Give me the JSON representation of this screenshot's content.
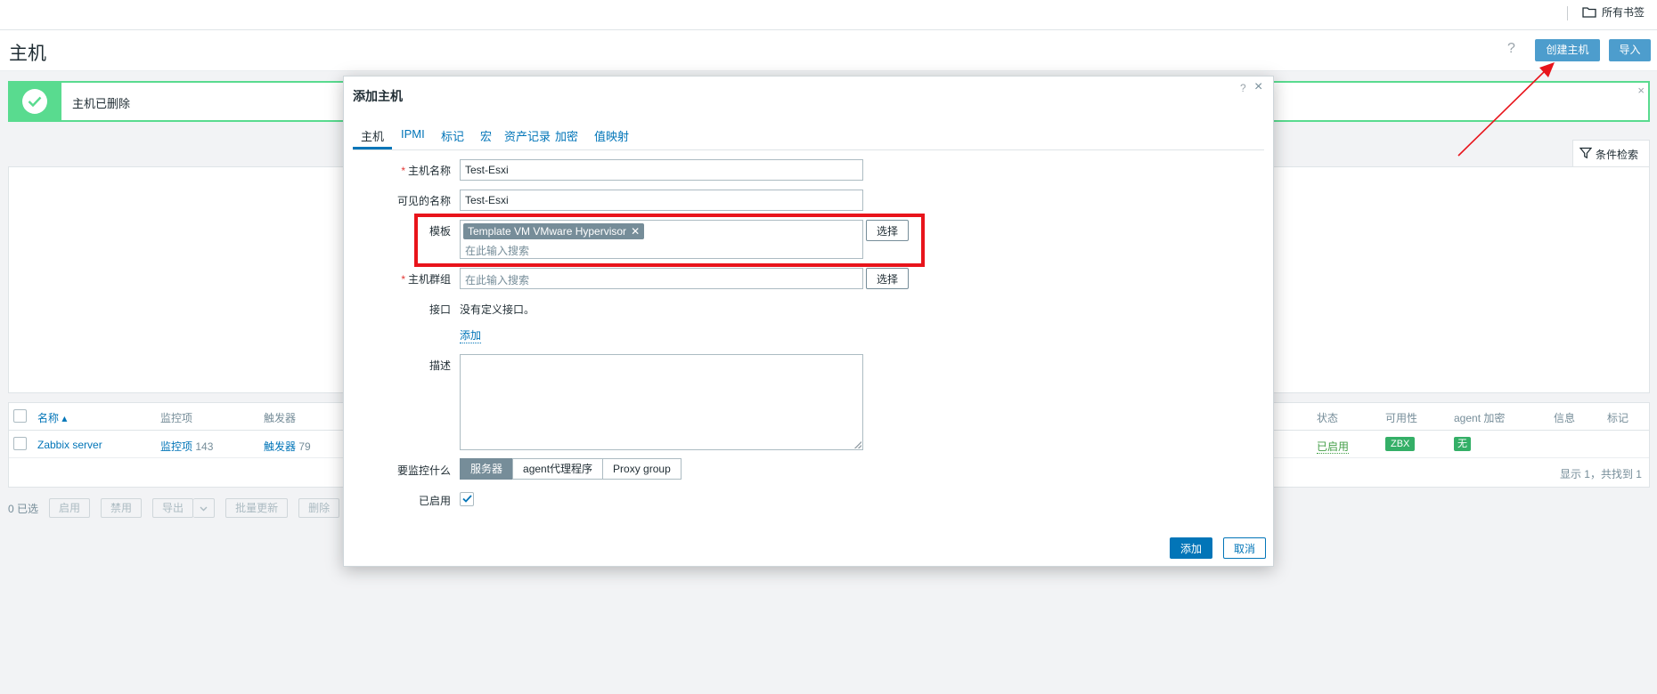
{
  "bookmarks": {
    "label": "所有书签",
    "icon": "folder-icon"
  },
  "header": {
    "title": "主机",
    "help": "?",
    "create_host": "创建主机",
    "import": "导入"
  },
  "message": {
    "text": "主机已删除",
    "icon": "check-circle-icon",
    "close": "×"
  },
  "filter": {
    "label": "条件检索",
    "icon": "funnel-icon"
  },
  "table": {
    "columns": {
      "name": "名称 ▴",
      "items": "监控项",
      "triggers": "触发器",
      "status": "状态",
      "availability": "可用性",
      "agent_encryption": "agent 加密",
      "info": "信息",
      "tags": "标记"
    },
    "rows": [
      {
        "name": "Zabbix server",
        "items_label": "监控项",
        "items_count": "143",
        "triggers_label": "触发器",
        "triggers_count": "79",
        "status": "已启用",
        "availability": "ZBX",
        "encryption": "无"
      }
    ],
    "footer": "显示 1，共找到 1"
  },
  "actions": {
    "selected": "0 已选",
    "enable": "启用",
    "disable": "禁用",
    "export": "导出",
    "mass_update": "批量更新",
    "delete": "删除"
  },
  "modal": {
    "title": "添加主机",
    "help": "?",
    "close": "×",
    "tabs": [
      "主机",
      "IPMI",
      "标记",
      "宏",
      "资产记录",
      "加密",
      "值映射"
    ],
    "fields": {
      "host_name_label": "主机名称",
      "host_name_value": "Test-Esxi",
      "visible_name_label": "可见的名称",
      "visible_name_value": "Test-Esxi",
      "templates_label": "模板",
      "template_chip": "Template VM VMware Hypervisor",
      "template_chip_remove": "✕",
      "search_placeholder": "在此输入搜索",
      "select": "选择",
      "host_groups_label": "主机群组",
      "interfaces_label": "接口",
      "interfaces_text": "没有定义接口。",
      "add_link": "添加",
      "description_label": "描述",
      "monitored_by_label": "要监控什么",
      "monitored_by_options": [
        "服务器",
        "agent代理程序",
        "Proxy group"
      ],
      "enabled_label": "已启用"
    },
    "buttons": {
      "add": "添加",
      "cancel": "取消"
    }
  },
  "annotation": {
    "color": "#e8141b"
  }
}
